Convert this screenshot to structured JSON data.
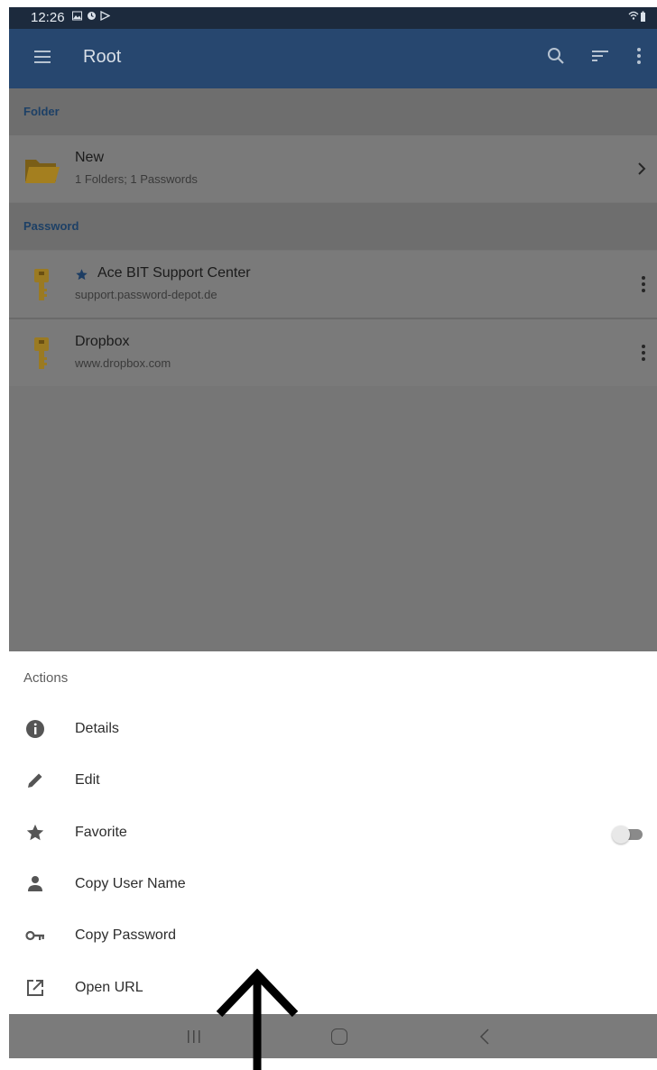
{
  "status_bar": {
    "time": "12:26"
  },
  "app_bar": {
    "title": "Root"
  },
  "sections": {
    "folder": "Folder",
    "password": "Password"
  },
  "folder_item": {
    "name": "New",
    "details": "1 Folders; 1 Passwords"
  },
  "password_items": [
    {
      "name": "Ace BIT Support Center",
      "url": "support.password-depot.de",
      "favorite": true
    },
    {
      "name": "Dropbox",
      "url": "www.dropbox.com",
      "favorite": false
    }
  ],
  "actions_sheet": {
    "heading": "Actions",
    "items": [
      {
        "label": "Details",
        "icon": "info-icon"
      },
      {
        "label": "Edit",
        "icon": "pencil-icon"
      },
      {
        "label": "Favorite",
        "icon": "star-icon",
        "toggle_on": false
      },
      {
        "label": "Copy User Name",
        "icon": "person-icon"
      },
      {
        "label": "Copy Password",
        "icon": "key-icon"
      },
      {
        "label": "Open URL",
        "icon": "open-external-icon"
      }
    ]
  },
  "colors": {
    "app_bar": "#27476f",
    "section_text": "#1d4066",
    "key_icon": "#c9a22c"
  }
}
